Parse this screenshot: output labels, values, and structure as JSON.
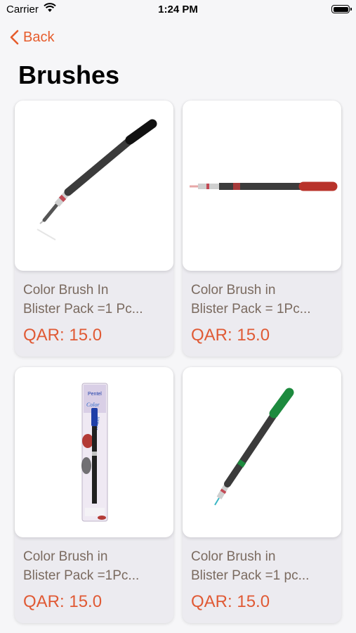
{
  "status_bar": {
    "carrier": "Carrier",
    "time": "1:24 PM"
  },
  "nav": {
    "back_label": "Back",
    "title": "Brushes"
  },
  "products": [
    {
      "name": "Color Brush In\nBlister Pack =1 Pc...",
      "price": "QAR: 15.0",
      "tip_color": "#111111",
      "image": "black-brush-pen"
    },
    {
      "name": "Color Brush in\nBlister Pack = 1Pc...",
      "price": "QAR: 15.0",
      "tip_color": "#b8322a",
      "image": "red-brush-pen"
    },
    {
      "name": "Color Brush in\nBlister Pack =1Pc...",
      "price": "QAR: 15.0",
      "tip_color": "#1f3fa8",
      "image": "blue-brush-pen-blister-pack"
    },
    {
      "name": "Color Brush in\nBlister Pack =1 pc...",
      "price": "QAR: 15.0",
      "tip_color": "#1d8a3e",
      "image": "green-brush-pen"
    }
  ],
  "colors": {
    "accent": "#e65c2c",
    "price": "#e05a35",
    "product_name": "#7a6a5f"
  }
}
